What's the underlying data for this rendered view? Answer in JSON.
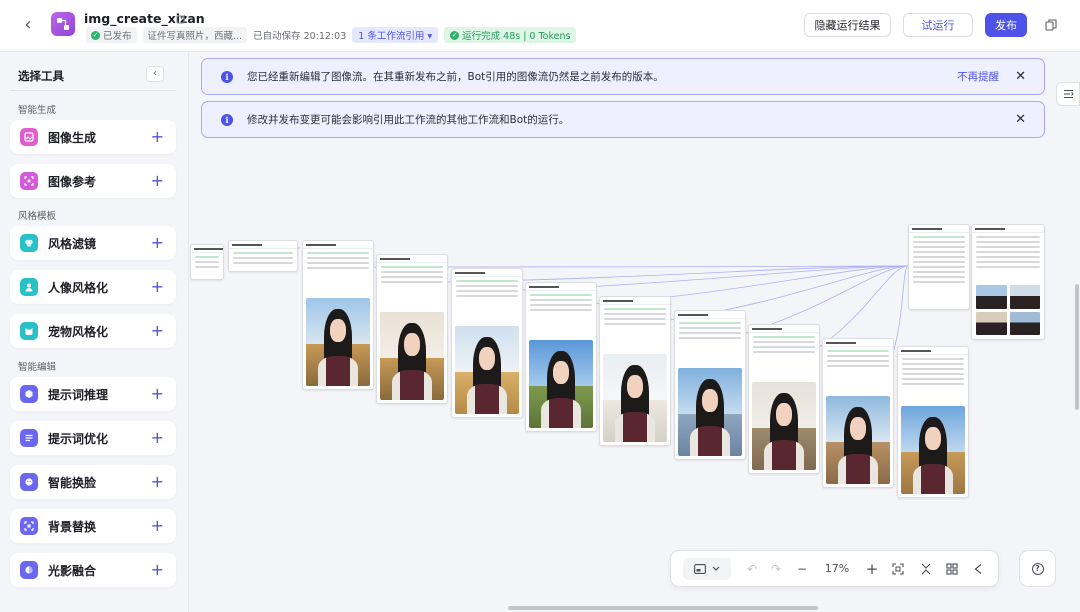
{
  "header": {
    "back_icon": "chevron-left-icon",
    "app_icon": "workflow-icon",
    "title": "img_create_xizan",
    "edit_icon": "edit-icon",
    "publish_status": "已发布",
    "description": "证件写真照片，西藏...",
    "autosave": "已自动保存 20:12:03",
    "ref_chip": "1 条工作流引用 ▾",
    "run_status": "运行完成 48s | 0 Tokens",
    "buttons": {
      "hide_result": "隐藏运行结果",
      "try_run": "试运行",
      "publish": "发布"
    },
    "accent_color": "#4d53e8",
    "success_color": "#2cb56a"
  },
  "sidebar": {
    "title": "选择工具",
    "collapse_icon": "chevron-left-icon",
    "sections": [
      {
        "label": "智能生成",
        "items": [
          {
            "label": "图像生成",
            "icon": "image-generate-icon",
            "color": "#e05fd0"
          },
          {
            "label": "图像参考",
            "icon": "image-reference-icon",
            "color": "#d35bd9"
          }
        ]
      },
      {
        "label": "风格模板",
        "items": [
          {
            "label": "风格滤镜",
            "icon": "style-filter-icon",
            "color": "#27c1c7"
          },
          {
            "label": "人像风格化",
            "icon": "portrait-style-icon",
            "color": "#27c1c7"
          },
          {
            "label": "宠物风格化",
            "icon": "pet-style-icon",
            "color": "#27c1c7"
          }
        ]
      },
      {
        "label": "智能编辑",
        "items": [
          {
            "label": "提示词推理",
            "icon": "prompt-reasoning-icon",
            "color": "#6a67f0"
          },
          {
            "label": "提示词优化",
            "icon": "prompt-optimize-icon",
            "color": "#6a67f0"
          },
          {
            "label": "智能换脸",
            "icon": "face-swap-icon",
            "color": "#6a67f0"
          },
          {
            "label": "背景替换",
            "icon": "background-replace-icon",
            "color": "#6a67f0"
          },
          {
            "label": "光影融合",
            "icon": "light-blend-icon",
            "color": "#6a67f0"
          }
        ]
      }
    ]
  },
  "banners": [
    {
      "text": "您已经重新编辑了图像流。在其重新发布之前，Bot引用的图像流仍然是之前发布的版本。",
      "link": "不再提醒"
    },
    {
      "text": "修改并发布变更可能会影响引用此工作流的其他工作流和Bot的运行。",
      "link": ""
    }
  ],
  "toolbar": {
    "zoom": "17%",
    "icons": [
      "minimap-icon",
      "undo-icon",
      "redo-icon",
      "zoom-out-icon",
      "zoom-in-icon",
      "fit-view-icon",
      "collapse-icon",
      "layout-icon",
      "direction-icon"
    ]
  },
  "help_icon": "help-icon"
}
